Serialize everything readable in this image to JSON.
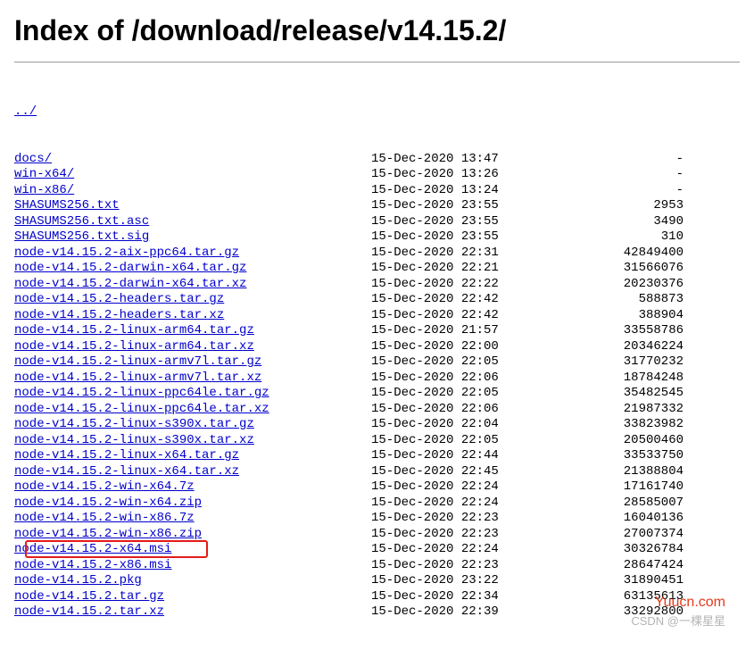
{
  "title": "Index of /download/release/v14.15.2/",
  "parent": {
    "name": "../"
  },
  "files": [
    {
      "name": "docs/",
      "date": "15-Dec-2020 13:47",
      "size": "-"
    },
    {
      "name": "win-x64/",
      "date": "15-Dec-2020 13:26",
      "size": "-"
    },
    {
      "name": "win-x86/",
      "date": "15-Dec-2020 13:24",
      "size": "-"
    },
    {
      "name": "SHASUMS256.txt",
      "date": "15-Dec-2020 23:55",
      "size": "2953"
    },
    {
      "name": "SHASUMS256.txt.asc",
      "date": "15-Dec-2020 23:55",
      "size": "3490"
    },
    {
      "name": "SHASUMS256.txt.sig",
      "date": "15-Dec-2020 23:55",
      "size": "310"
    },
    {
      "name": "node-v14.15.2-aix-ppc64.tar.gz",
      "date": "15-Dec-2020 22:31",
      "size": "42849400"
    },
    {
      "name": "node-v14.15.2-darwin-x64.tar.gz",
      "date": "15-Dec-2020 22:21",
      "size": "31566076"
    },
    {
      "name": "node-v14.15.2-darwin-x64.tar.xz",
      "date": "15-Dec-2020 22:22",
      "size": "20230376"
    },
    {
      "name": "node-v14.15.2-headers.tar.gz",
      "date": "15-Dec-2020 22:42",
      "size": "588873"
    },
    {
      "name": "node-v14.15.2-headers.tar.xz",
      "date": "15-Dec-2020 22:42",
      "size": "388904"
    },
    {
      "name": "node-v14.15.2-linux-arm64.tar.gz",
      "date": "15-Dec-2020 21:57",
      "size": "33558786"
    },
    {
      "name": "node-v14.15.2-linux-arm64.tar.xz",
      "date": "15-Dec-2020 22:00",
      "size": "20346224"
    },
    {
      "name": "node-v14.15.2-linux-armv7l.tar.gz",
      "date": "15-Dec-2020 22:05",
      "size": "31770232"
    },
    {
      "name": "node-v14.15.2-linux-armv7l.tar.xz",
      "date": "15-Dec-2020 22:06",
      "size": "18784248"
    },
    {
      "name": "node-v14.15.2-linux-ppc64le.tar.gz",
      "date": "15-Dec-2020 22:05",
      "size": "35482545"
    },
    {
      "name": "node-v14.15.2-linux-ppc64le.tar.xz",
      "date": "15-Dec-2020 22:06",
      "size": "21987332"
    },
    {
      "name": "node-v14.15.2-linux-s390x.tar.gz",
      "date": "15-Dec-2020 22:04",
      "size": "33823982"
    },
    {
      "name": "node-v14.15.2-linux-s390x.tar.xz",
      "date": "15-Dec-2020 22:05",
      "size": "20500460"
    },
    {
      "name": "node-v14.15.2-linux-x64.tar.gz",
      "date": "15-Dec-2020 22:44",
      "size": "33533750"
    },
    {
      "name": "node-v14.15.2-linux-x64.tar.xz",
      "date": "15-Dec-2020 22:45",
      "size": "21388804"
    },
    {
      "name": "node-v14.15.2-win-x64.7z",
      "date": "15-Dec-2020 22:24",
      "size": "17161740"
    },
    {
      "name": "node-v14.15.2-win-x64.zip",
      "date": "15-Dec-2020 22:24",
      "size": "28585007"
    },
    {
      "name": "node-v14.15.2-win-x86.7z",
      "date": "15-Dec-2020 22:23",
      "size": "16040136"
    },
    {
      "name": "node-v14.15.2-win-x86.zip",
      "date": "15-Dec-2020 22:23",
      "size": "27007374"
    },
    {
      "name": "node-v14.15.2-x64.msi",
      "date": "15-Dec-2020 22:24",
      "size": "30326784",
      "highlighted": true
    },
    {
      "name": "node-v14.15.2-x86.msi",
      "date": "15-Dec-2020 22:23",
      "size": "28647424"
    },
    {
      "name": "node-v14.15.2.pkg",
      "date": "15-Dec-2020 23:22",
      "size": "31890451"
    },
    {
      "name": "node-v14.15.2.tar.gz",
      "date": "15-Dec-2020 22:34",
      "size": "63135613"
    },
    {
      "name": "node-v14.15.2.tar.xz",
      "date": "15-Dec-2020 22:39",
      "size": "33292800"
    }
  ],
  "watermark": {
    "main": "Yuucn.com",
    "csdn": "CSDN @一棵星星"
  }
}
